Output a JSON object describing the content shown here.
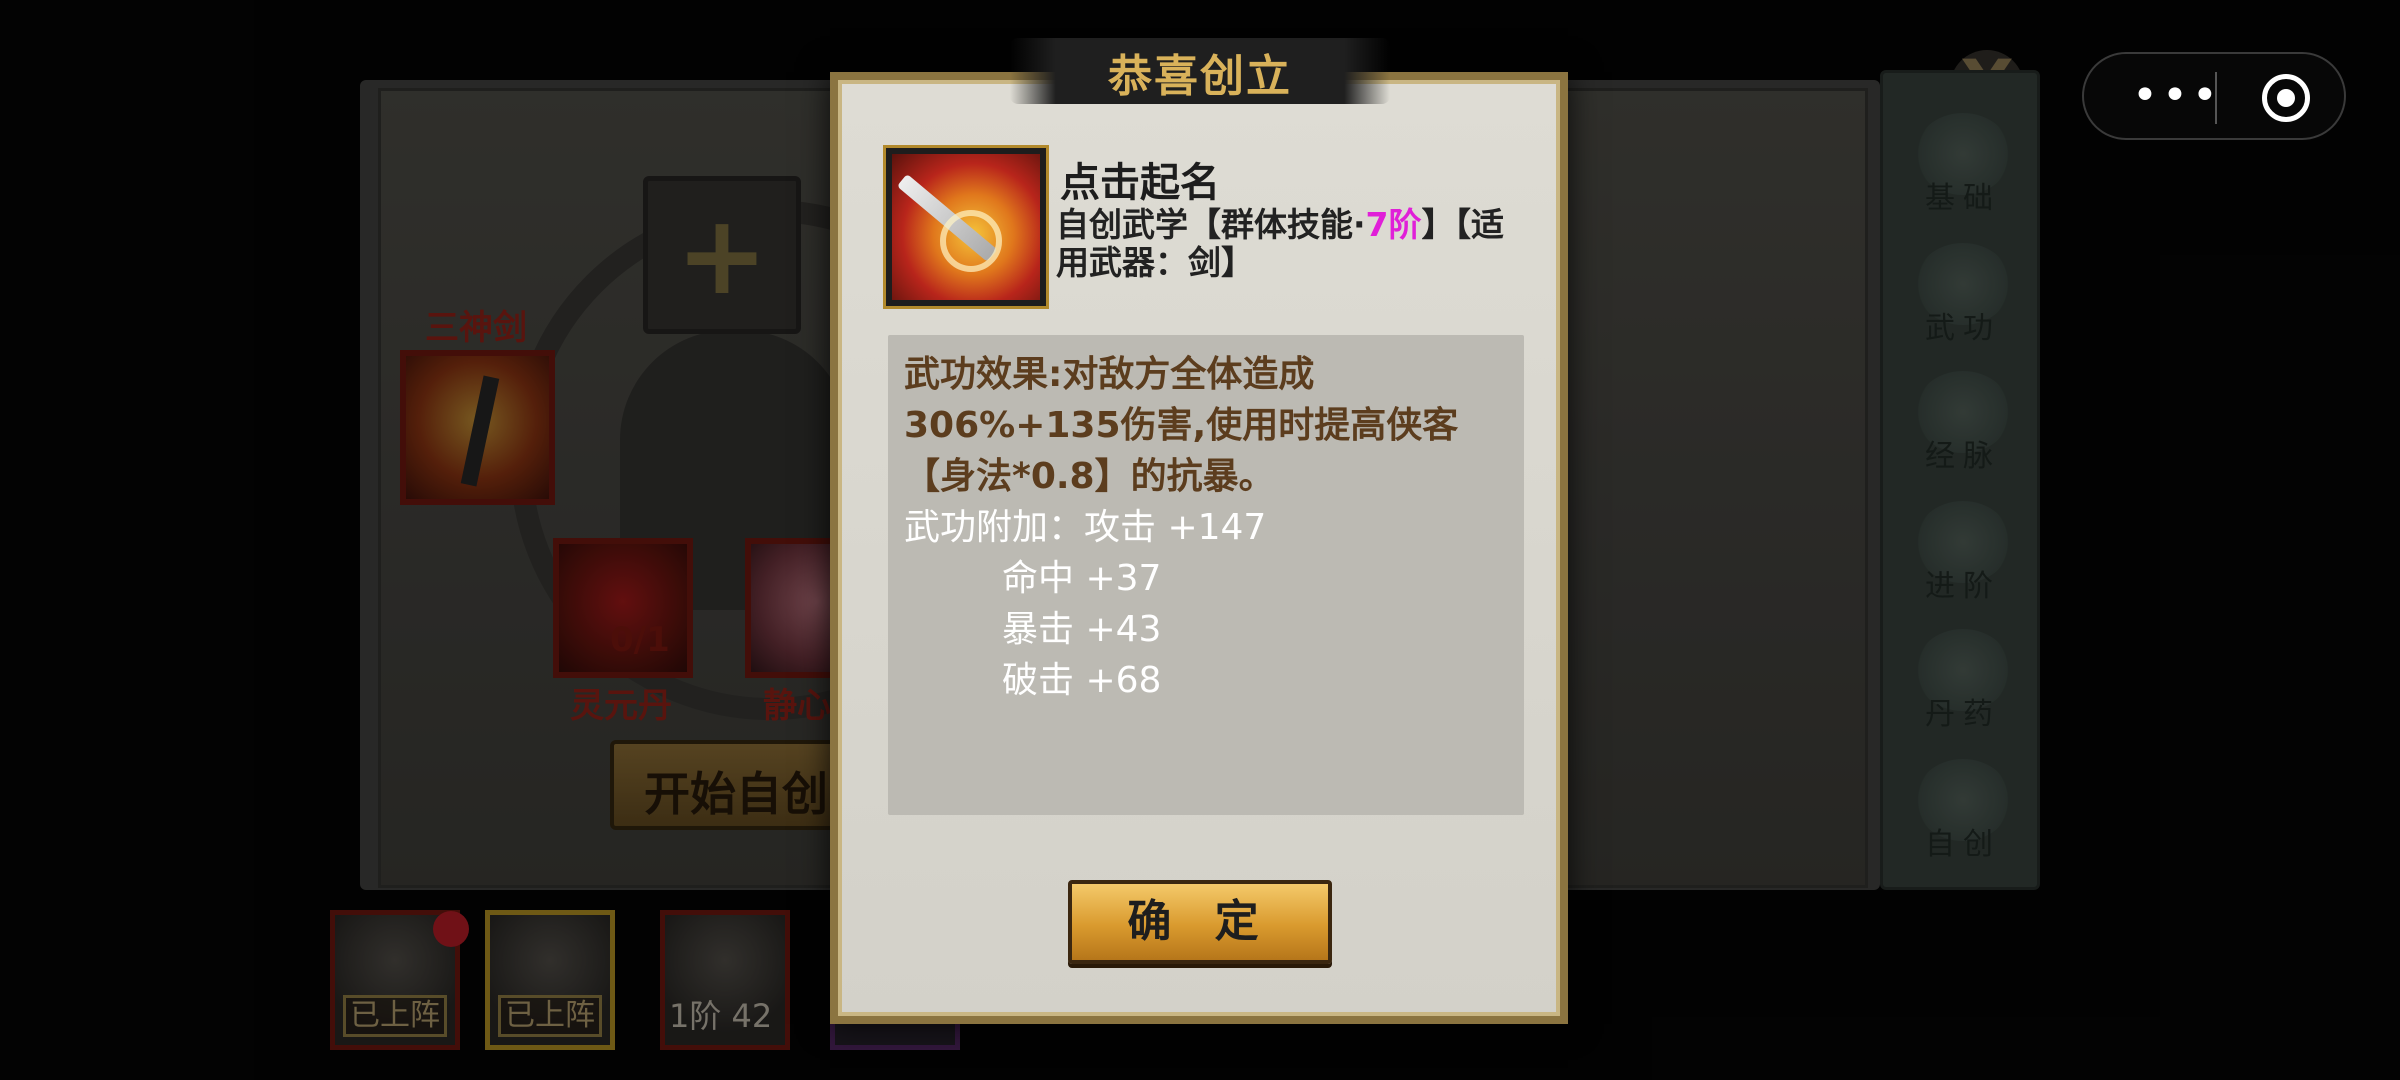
{
  "dialog": {
    "title": "恭喜创立",
    "skill_name": "点击起名",
    "skill_type_prefix": "自创武学【群体技能·",
    "skill_grade": "7阶",
    "skill_type_suffix": "】【适用武器：剑】",
    "effect_text": "武功效果:对敌方全体造成306%+135伤害,使用时提高侠客【身法*0.8】的抗暴。",
    "stats": [
      {
        "label": "武功附加：攻击 +147"
      },
      {
        "label": "命中 +37"
      },
      {
        "label": "暴击 +43"
      },
      {
        "label": "破击 +68"
      }
    ],
    "confirm_label": "确 定"
  },
  "background": {
    "sword_label": "三神剑",
    "pill_label": "灵元丹",
    "pill_count": "0/1",
    "lotus_label": "静心",
    "start_button": "开始自创",
    "plus_symbol": "+",
    "close_symbol": "X"
  },
  "sidebar": {
    "items": [
      {
        "label": "基础"
      },
      {
        "label": "武功"
      },
      {
        "label": "经脉"
      },
      {
        "label": "进阶"
      },
      {
        "label": "丹药"
      },
      {
        "label": "自创"
      }
    ]
  },
  "heroes": [
    {
      "tag": "已上阵"
    },
    {
      "tag": "已上阵"
    },
    {
      "level": "1阶 42"
    }
  ],
  "capsule": {
    "menu_dots": "•••"
  },
  "colors": {
    "grade_highlight": "#e01fd8",
    "title_gold": "#d9b25a",
    "effect_brown": "#5c3d1e",
    "stat_white": "#ffffff"
  }
}
